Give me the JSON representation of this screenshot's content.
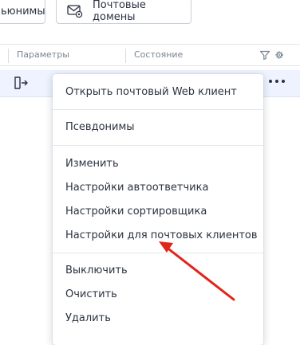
{
  "toolbar": {
    "left_button_label": "ьюнимы",
    "mail_domains_label": "Почтовые домены",
    "mail_domains_icon": "mail-settings-icon"
  },
  "table": {
    "columns": [
      "Параметры",
      "Состояние"
    ],
    "filter_icon": "filter-icon",
    "settings_icon": "gear-icon",
    "row": {
      "icon": "login-icon",
      "selected": true,
      "actions_icon": "more-horizontal-icon"
    }
  },
  "context_menu": {
    "groups": [
      [
        "Открыть почтовый Web клиент"
      ],
      [
        "Псевдонимы"
      ],
      [
        "Изменить",
        "Настройки автоответчика",
        "Настройки сортировщика",
        "Настройки для почтовых клиентов"
      ],
      [
        "Выключить",
        "Очистить",
        "Удалить"
      ]
    ]
  },
  "annotation": {
    "type": "arrow",
    "color": "#e2231a",
    "points_to": "Настройки для почтовых клиентов"
  },
  "colors": {
    "selected_row": "#eef3ff",
    "text": "#2b3241",
    "muted_text": "#7a8394",
    "border": "#e1e5eb"
  }
}
